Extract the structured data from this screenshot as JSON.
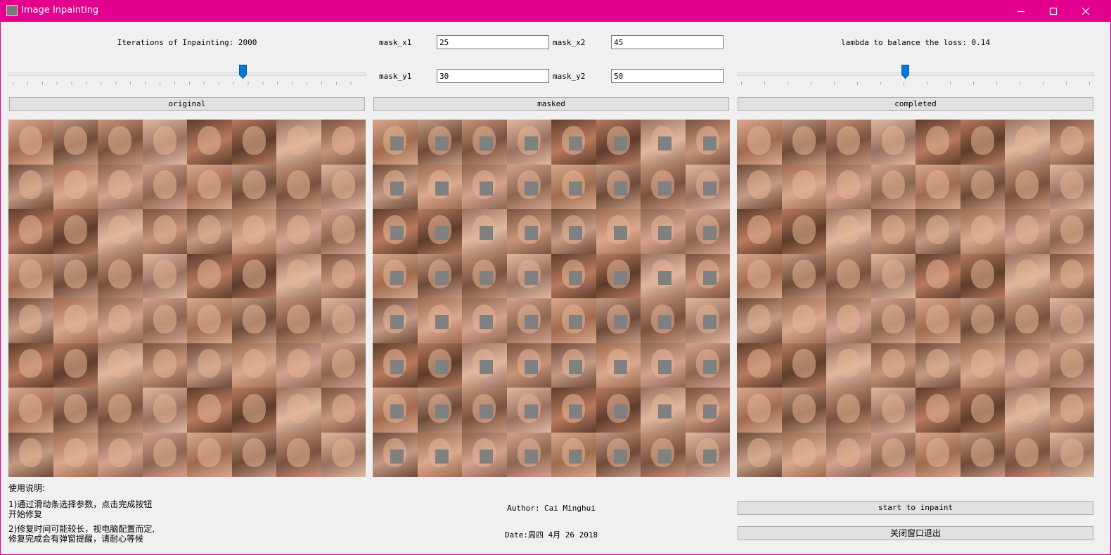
{
  "window": {
    "title": "Image Inpainting",
    "icon": "app-icon",
    "buttons": [
      "minimize-icon",
      "maximize-icon",
      "close-icon"
    ],
    "accent_color": "#e3008c"
  },
  "controls": {
    "iterations_label": "Iterations of Inpainting: 2000",
    "iterations_value": 2000,
    "iterations_slider_fraction": 0.66,
    "lambda_label": "lambda to balance the loss: 0.14",
    "lambda_value": 0.14,
    "lambda_slider_fraction": 0.47,
    "mask_x1_label": "mask_x1",
    "mask_x1_value": "25",
    "mask_x2_label": "mask_x2",
    "mask_x2_value": "45",
    "mask_y1_label": "mask_y1",
    "mask_y1_value": "30",
    "mask_y2_label": "mask_y2",
    "mask_y2_value": "50"
  },
  "panels": {
    "original_label": "original",
    "masked_label": "masked",
    "completed_label": "completed"
  },
  "footer": {
    "instructions_title": "使用说明:",
    "instruction_1_line1": "1)通过滑动条选择参数，点击完成按钮",
    "instruction_1_line2": "开始修复",
    "instruction_2_line1": "2)修复时间可能较长，视电脑配置而定,",
    "instruction_2_line2": "修复完成会有弹窗提醒，请耐心等候",
    "author": "Author: Cai Minghui",
    "date": "Date:周四 4月 26 2018",
    "start_button": "start to inpaint",
    "exit_button": "关闭窗口退出"
  }
}
